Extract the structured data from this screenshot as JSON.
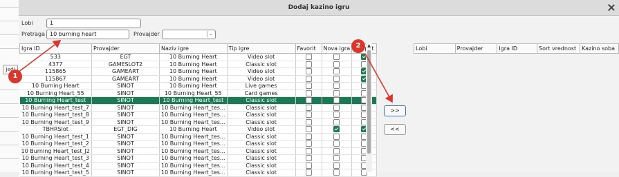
{
  "window": {
    "title": "Dodaj kazino igru",
    "left_button": "Jedi"
  },
  "form": {
    "lobi_label": "Lobi",
    "lobi_value": "1",
    "pretraga_label": "Pretraga",
    "pretraga_value": "10 burning heart",
    "provajder_label": "Provajder",
    "provajder_value": ""
  },
  "games_table": {
    "columns": [
      "Igra ID",
      "Provajder",
      "Naziv igre",
      "Tip igre",
      "Favorit",
      "Nova igra",
      "Jackpot"
    ],
    "rows": [
      {
        "id": "533",
        "provider": "EGT",
        "name": "10 Burning Heart",
        "type": "Video slot",
        "favorit": false,
        "nova": false,
        "jackpot": true,
        "selected": false
      },
      {
        "id": "4377",
        "provider": "GAMESLOT2",
        "name": "10 Burning Heart",
        "type": "Classic slot",
        "favorit": false,
        "nova": false,
        "jackpot": false,
        "selected": false
      },
      {
        "id": "115865",
        "provider": "GAMEART",
        "name": "10 Burning Heart",
        "type": "Video slot",
        "favorit": false,
        "nova": false,
        "jackpot": true,
        "selected": false
      },
      {
        "id": "115867",
        "provider": "GAMEART",
        "name": "10 Burning Heart",
        "type": "Video slot",
        "favorit": false,
        "nova": false,
        "jackpot": true,
        "selected": false
      },
      {
        "id": "10 Burning Heart",
        "provider": "SINOT",
        "name": "10 Burning Heart",
        "type": "Live games",
        "favorit": false,
        "nova": false,
        "jackpot": false,
        "selected": false
      },
      {
        "id": "10 Burning Heart_55",
        "provider": "SINOT",
        "name": "10 Burning Heart_55",
        "type": "Card games",
        "favorit": false,
        "nova": false,
        "jackpot": false,
        "selected": false
      },
      {
        "id": "10 Burning Heart_test",
        "provider": "SINOT",
        "name": "10 Burning Heart_test",
        "type": "Classic slot",
        "favorit": false,
        "nova": false,
        "jackpot": false,
        "selected": true
      },
      {
        "id": "10 Burning Heart_test_7",
        "provider": "SINOT",
        "name": "10 Burning Heart_tes...",
        "type": "Classic slot",
        "favorit": false,
        "nova": false,
        "jackpot": false,
        "selected": false
      },
      {
        "id": "10 Burning Heart_test_8",
        "provider": "SINOT",
        "name": "10 Burning Heart_tes...",
        "type": "Classic slot",
        "favorit": false,
        "nova": false,
        "jackpot": false,
        "selected": false
      },
      {
        "id": "10 Burning Heart_test_9",
        "provider": "SINOT",
        "name": "10 Burning Heart_tes...",
        "type": "Classic slot",
        "favorit": false,
        "nova": false,
        "jackpot": false,
        "selected": false
      },
      {
        "id": "TBHRSlot",
        "provider": "EGT_DIG",
        "name": "10 Burning Heart",
        "type": "Video slot",
        "favorit": false,
        "nova": true,
        "jackpot": true,
        "selected": false
      },
      {
        "id": "10 Burning Heart_test_1",
        "provider": "SINOT",
        "name": "10 Burning Heart_tes...",
        "type": "Classic slot",
        "favorit": false,
        "nova": false,
        "jackpot": false,
        "selected": false
      },
      {
        "id": "10 Burning Heart_test_2",
        "provider": "SINOT",
        "name": "10 Burning Heart_tes...",
        "type": "Classic slot",
        "favorit": false,
        "nova": false,
        "jackpot": false,
        "selected": false
      },
      {
        "id": "10 Burning Heart_test_J2",
        "provider": "SINOT",
        "name": "10 Burning Heart_tes...",
        "type": "Classic slot",
        "favorit": false,
        "nova": false,
        "jackpot": false,
        "selected": false
      },
      {
        "id": "10 Burning Heart_test_3",
        "provider": "SINOT",
        "name": "10 Burning Heart_tes...",
        "type": "Classic slot",
        "favorit": false,
        "nova": false,
        "jackpot": false,
        "selected": false
      },
      {
        "id": "10 Burning Heart_test_4",
        "provider": "SINOT",
        "name": "10 Burning Heart_tes...",
        "type": "Classic slot",
        "favorit": false,
        "nova": false,
        "jackpot": false,
        "selected": false
      },
      {
        "id": "10 Burning Heart_test_5",
        "provider": "SINOT",
        "name": "10 Burning Heart_tes...",
        "type": "Classic slot",
        "favorit": false,
        "nova": false,
        "jackpot": false,
        "selected": false
      }
    ]
  },
  "buttons": {
    "add": ">>",
    "remove": "<<"
  },
  "lobby_table": {
    "columns": [
      "Lobi",
      "Provajder",
      "Igra ID",
      "Sort vrednost",
      "Kazino soba"
    ]
  },
  "annotations": {
    "badge1": "1",
    "badge2": "2",
    "badge_color": "#d9372b"
  },
  "colors": {
    "selected_row": "#1b7a55",
    "checkbox_on": "#1f7a55"
  }
}
